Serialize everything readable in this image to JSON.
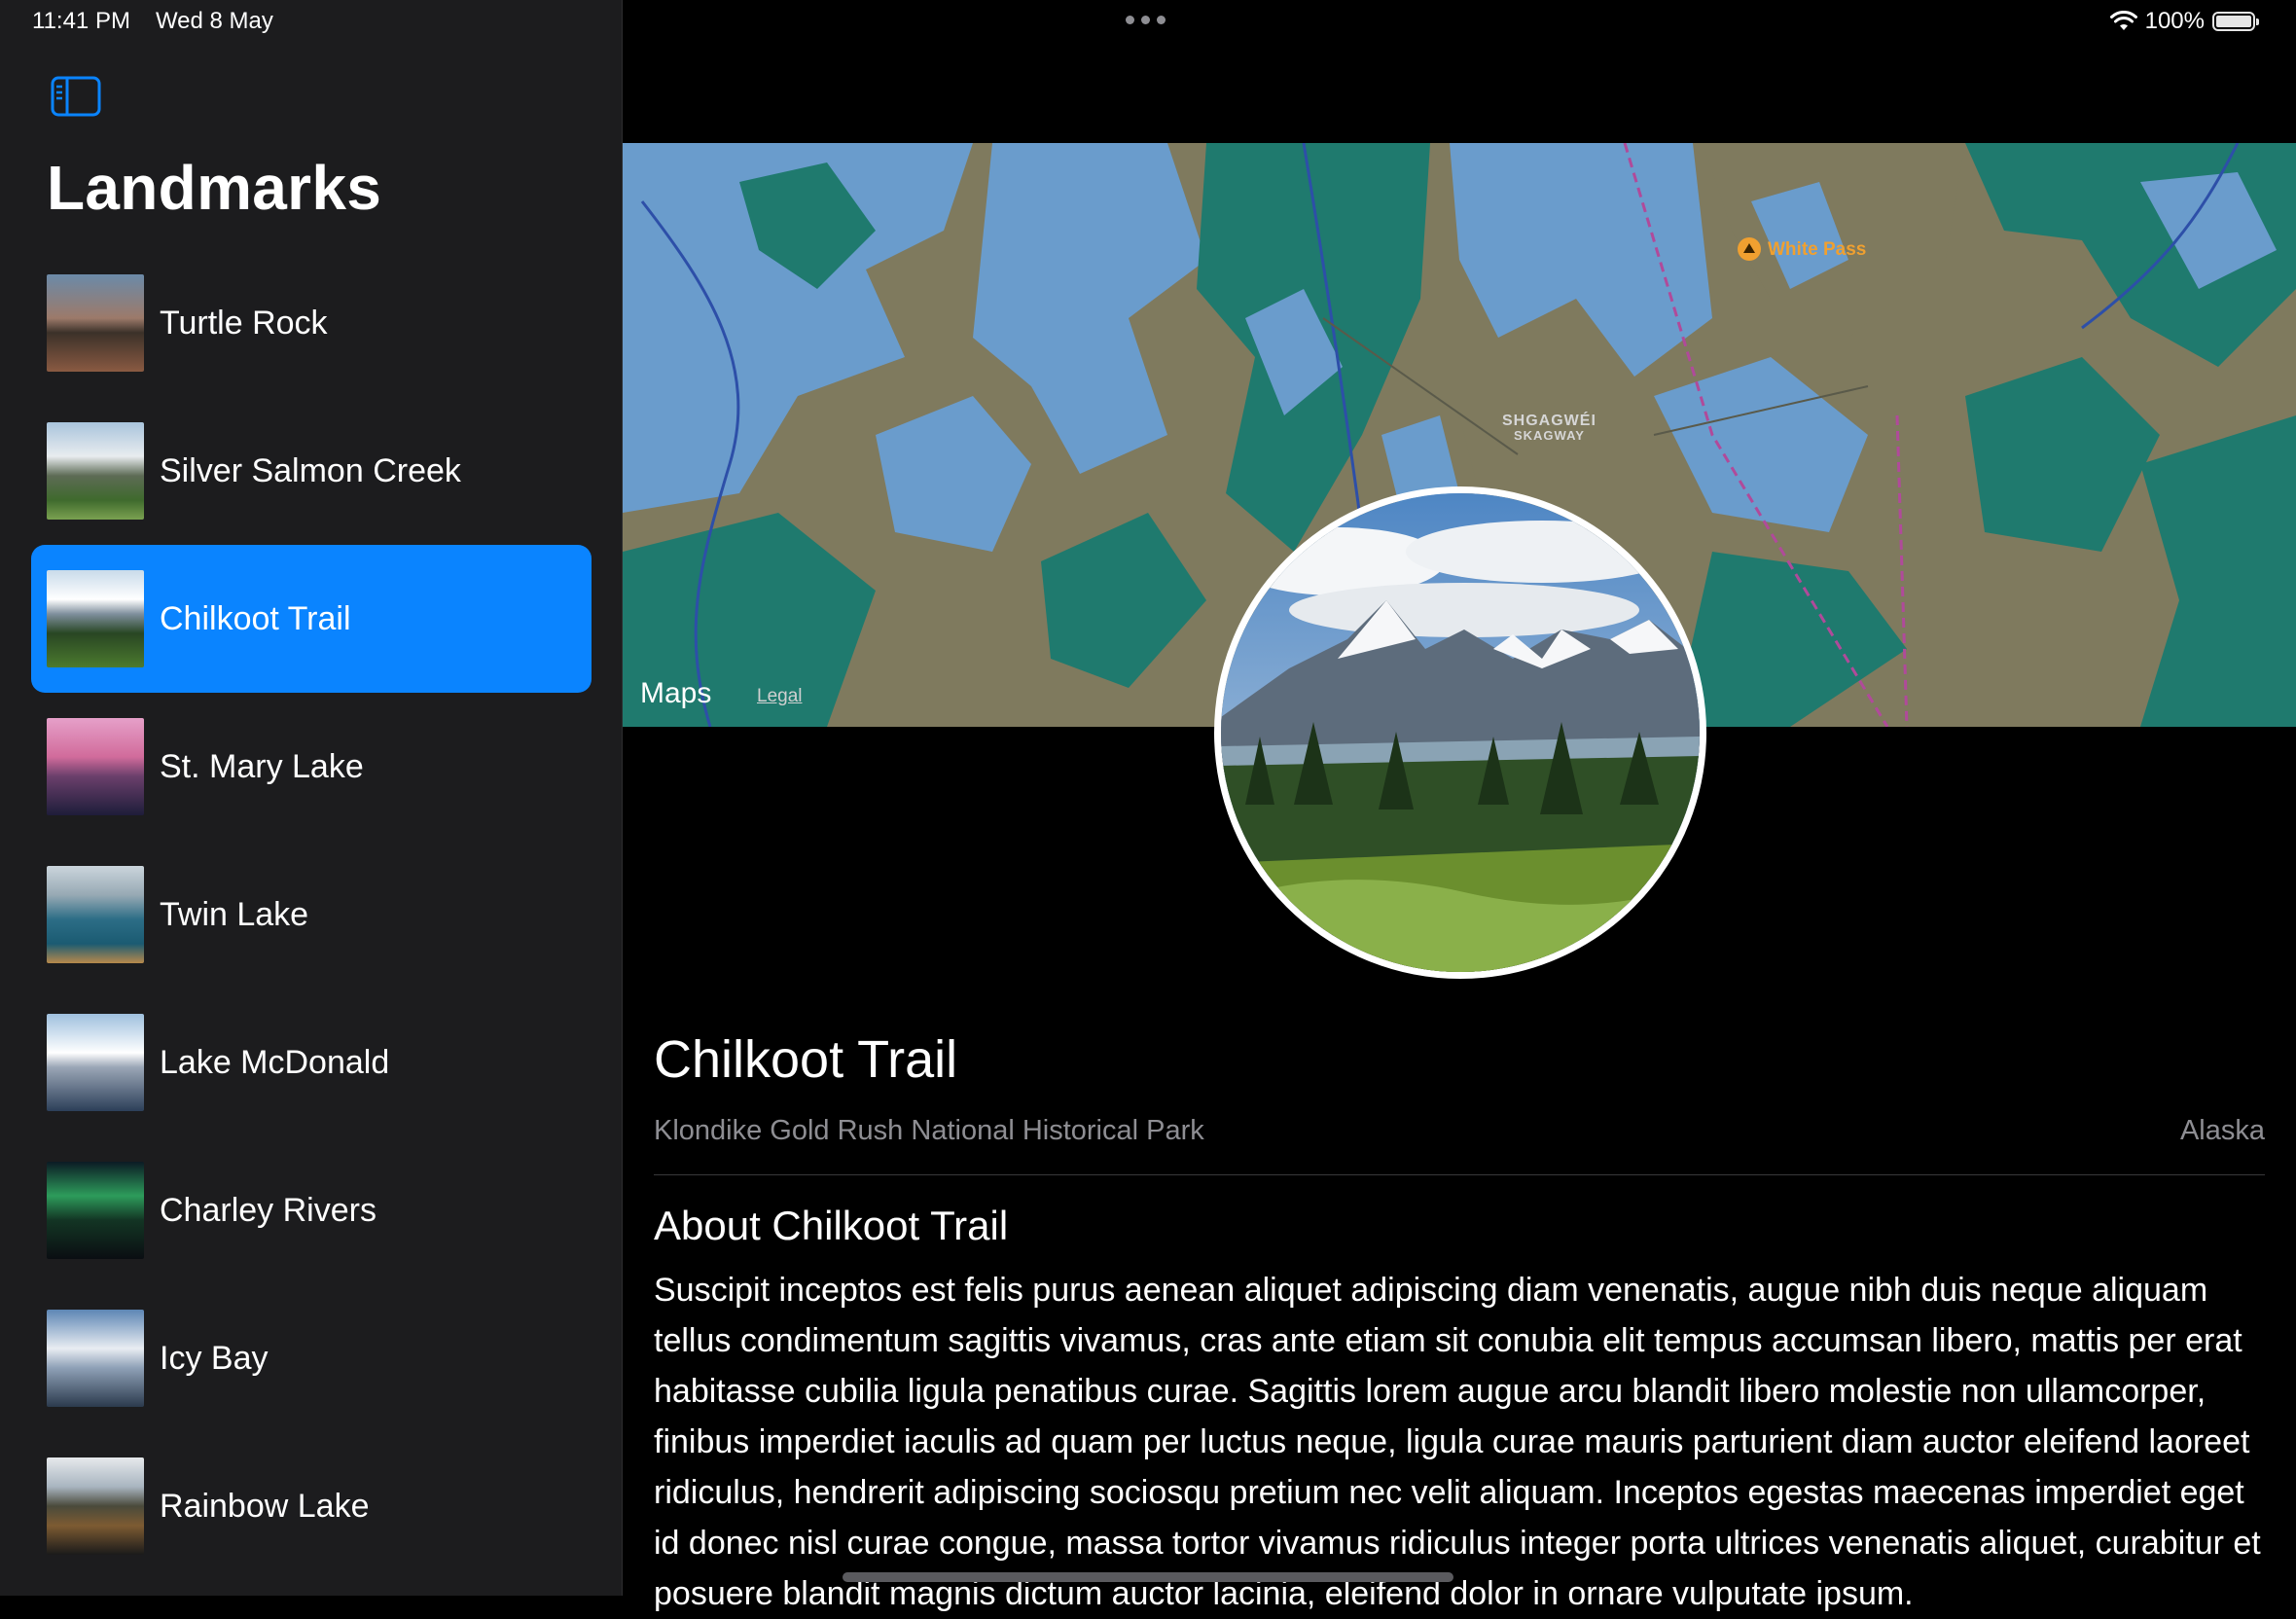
{
  "status_bar": {
    "time": "11:41 PM",
    "date": "Wed 8 May",
    "battery": "100%"
  },
  "sidebar": {
    "title": "Landmarks",
    "items": [
      {
        "label": "Turtle Rock"
      },
      {
        "label": "Silver Salmon Creek"
      },
      {
        "label": "Chilkoot Trail",
        "selected": true
      },
      {
        "label": "St. Mary Lake"
      },
      {
        "label": "Twin Lake"
      },
      {
        "label": "Lake McDonald"
      },
      {
        "label": "Charley Rivers"
      },
      {
        "label": "Icy Bay"
      },
      {
        "label": "Rainbow Lake"
      }
    ]
  },
  "map": {
    "brand": "Maps",
    "legal": "Legal",
    "labels": {
      "pass": "White Pass",
      "town": "SHGAGWÉI",
      "town_alt": "SKAGWAY"
    }
  },
  "detail": {
    "title": "Chilkoot Trail",
    "park": "Klondike Gold Rush National Historical Park",
    "state": "Alaska",
    "about_heading": "About Chilkoot Trail",
    "description": "Suscipit inceptos est felis purus aenean aliquet adipiscing diam venenatis, augue nibh duis neque aliquam tellus condimentum sagittis vivamus, cras ante etiam sit conubia elit tempus accumsan libero, mattis per erat habitasse cubilia ligula penatibus curae. Sagittis lorem augue arcu blandit libero molestie non ullamcorper, finibus imperdiet iaculis ad quam per luctus neque, ligula curae mauris parturient diam auctor eleifend laoreet ridiculus, hendrerit adipiscing sociosqu pretium nec velit aliquam. Inceptos egestas maecenas imperdiet eget id donec nisl curae congue, massa tortor vivamus ridiculus integer porta ultrices venenatis aliquet, curabitur et posuere blandit magnis dictum auctor lacinia, eleifend dolor in ornare vulputate ipsum."
  },
  "colors": {
    "accent": "#0a84ff",
    "sidebar_bg": "#1c1c1e",
    "map_water": "#6a9ccc",
    "map_land": "#7f7a5e",
    "map_forest": "#1f7a6e"
  }
}
